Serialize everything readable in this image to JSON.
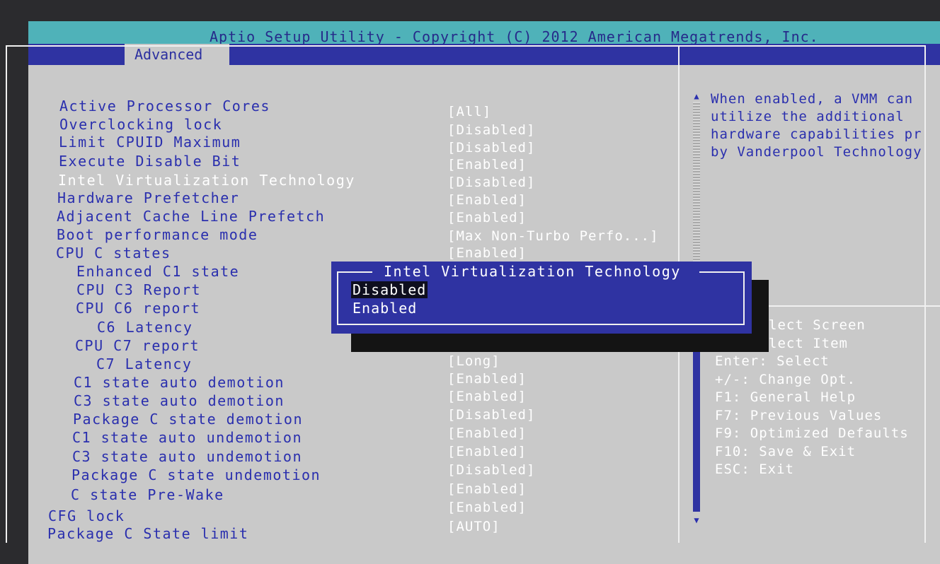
{
  "title": "Aptio Setup Utility - Copyright (C) 2012 American Megatrends, Inc.",
  "tab": "Advanced",
  "settings": [
    {
      "label": "Active Processor Cores",
      "value": "[All]"
    },
    {
      "label": "Overclocking lock",
      "value": "[Disabled]"
    },
    {
      "label": "Limit CPUID Maximum",
      "value": "[Disabled]"
    },
    {
      "label": "Execute Disable Bit",
      "value": "[Enabled]"
    },
    {
      "label": "Intel Virtualization Technology",
      "value": "[Disabled]"
    },
    {
      "label": "Hardware Prefetcher",
      "value": "[Enabled]"
    },
    {
      "label": "Adjacent Cache Line Prefetch",
      "value": "[Enabled]"
    },
    {
      "label": "Boot performance mode",
      "value": "[Max Non-Turbo Perfo...]"
    },
    {
      "label": "CPU C states",
      "value": "[Enabled]"
    },
    {
      "label": "Enhanced C1 state",
      "value": ""
    },
    {
      "label": "CPU C3 Report",
      "value": ""
    },
    {
      "label": "CPU C6 report",
      "value": ""
    },
    {
      "label": "C6 Latency",
      "value": ""
    },
    {
      "label": "CPU C7 report",
      "value": ""
    },
    {
      "label": "C7 Latency",
      "value": "[Long]"
    },
    {
      "label": "C1 state auto demotion",
      "value": "[Enabled]"
    },
    {
      "label": "C3 state auto demotion",
      "value": "[Enabled]"
    },
    {
      "label": "Package C state demotion",
      "value": "[Disabled]"
    },
    {
      "label": "C1 state auto undemotion",
      "value": "[Enabled]"
    },
    {
      "label": "C3 state auto undemotion",
      "value": "[Enabled]"
    },
    {
      "label": "Package C state undemotion",
      "value": "[Disabled]"
    },
    {
      "label": "C state Pre-Wake",
      "value": "[Enabled]"
    },
    {
      "label": "CFG lock",
      "value": "[Enabled]"
    },
    {
      "label": "Package C State limit",
      "value": "[AUTO]"
    }
  ],
  "help_text": [
    "When enabled, a VMM can",
    "utilize the additional",
    "hardware capabilities pr",
    "by Vanderpool Technology"
  ],
  "keys": [
    "lect Screen",
    "lect Item",
    "Enter: Select",
    "+/-: Change Opt.",
    "F1: General Help",
    "F7: Previous Values",
    "F9: Optimized Defaults",
    "F10: Save & Exit",
    "ESC: Exit"
  ],
  "popup": {
    "title": "Intel Virtualization Technology",
    "options": [
      "Disabled",
      "Enabled"
    ],
    "selected": 0
  },
  "colors": {
    "bios_blue": "#2f33a2",
    "title_cyan": "#4fb2b9",
    "panel_gray": "#c9c9c9",
    "text_white": "#ffffff"
  }
}
